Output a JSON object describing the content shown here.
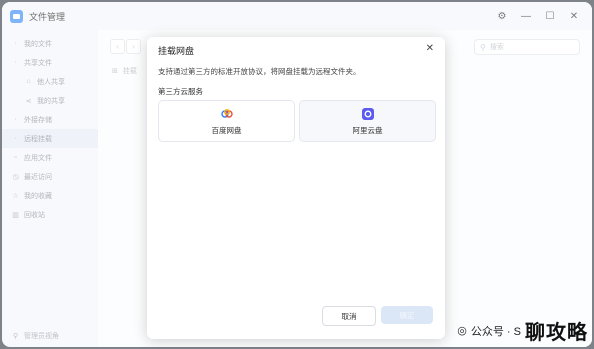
{
  "app": {
    "title": "文件管理",
    "icon": "folder-app-icon"
  },
  "window_controls": {
    "settings": "⚙",
    "minimize": "—",
    "maximize": "☐",
    "close": "✕"
  },
  "sidebar": {
    "items": [
      {
        "label": "我的文件",
        "icon": "dot"
      },
      {
        "label": "共享文件",
        "icon": "dot"
      },
      {
        "label": "他人共享",
        "icon": "share"
      },
      {
        "label": "我的共享",
        "icon": "share"
      },
      {
        "label": "外接存储",
        "icon": "dot"
      },
      {
        "label": "远程挂载",
        "icon": "dot"
      },
      {
        "label": "应用文件",
        "icon": "app"
      },
      {
        "label": "最近访问",
        "icon": "clock"
      },
      {
        "label": "我的收藏",
        "icon": "star"
      },
      {
        "label": "回收站",
        "icon": "trash"
      }
    ],
    "footer": "管理员视角"
  },
  "main": {
    "search_placeholder": "搜索",
    "crumb": "挂载"
  },
  "dialog": {
    "title": "挂载网盘",
    "description": "支持通过第三方的标准开放协议，将网盘挂载为远程文件夹。",
    "section": "第三方云服务",
    "services": [
      {
        "label": "百度网盘",
        "icon": "baidu-cloud-icon"
      },
      {
        "label": "阿里云盘",
        "icon": "aliyun-drive-icon"
      }
    ],
    "cancel": "取消",
    "ok": "确定"
  },
  "watermark": {
    "channel": "公众号 · S",
    "big": "聊攻略"
  },
  "colors": {
    "accent": "#3a8ef6",
    "ok_button": "#dbe6f7",
    "window_bg": "#f4f6fa"
  }
}
